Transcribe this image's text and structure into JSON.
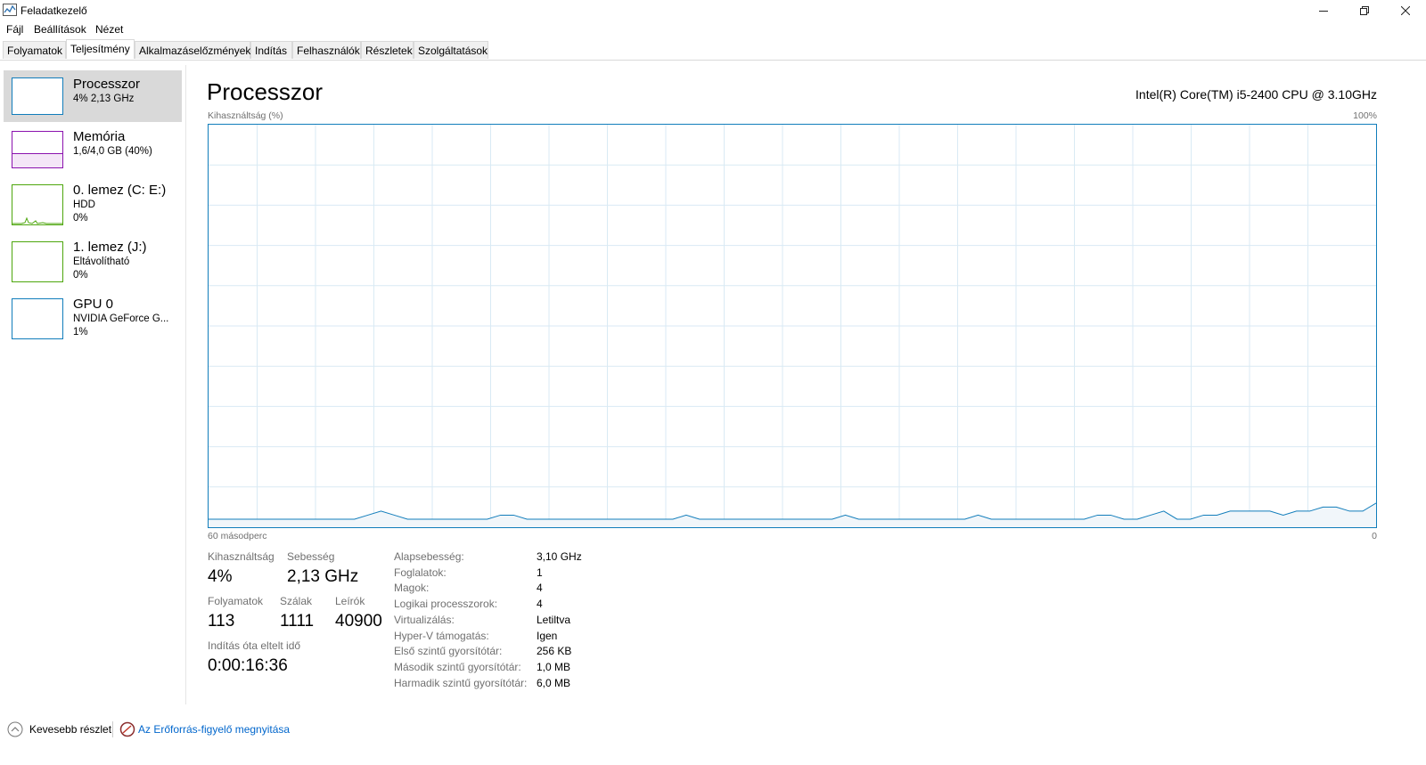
{
  "window": {
    "title": "Feladatkezelő",
    "minimize_icon": "minimize-icon",
    "restore_icon": "restore-icon",
    "close_icon": "close-icon"
  },
  "menu": [
    "Fájl",
    "Beállítások",
    "Nézet"
  ],
  "tabs": [
    "Folyamatok",
    "Teljesítmény",
    "Alkalmazáselőzmények",
    "Indítás",
    "Felhasználók",
    "Részletek",
    "Szolgáltatások"
  ],
  "active_tab": "Teljesítmény",
  "sidebar": {
    "items": [
      {
        "name": "Processzor",
        "sub1": "4% 2,13 GHz",
        "sub2": "",
        "color": "#117dbb",
        "selected": true
      },
      {
        "name": "Memória",
        "sub1": "1,6/4,0 GB (40%)",
        "sub2": "",
        "color": "#8b12ae",
        "selected": false
      },
      {
        "name": "0. lemez (C: E:)",
        "sub1": "HDD",
        "sub2": "0%",
        "color": "#4da60c",
        "selected": false
      },
      {
        "name": "1. lemez (J:)",
        "sub1": "Eltávolítható",
        "sub2": "0%",
        "color": "#4da60c",
        "selected": false
      },
      {
        "name": "GPU 0",
        "sub1": "NVIDIA GeForce G...",
        "sub2": "1%",
        "color": "#117dbb",
        "selected": false
      }
    ]
  },
  "main": {
    "title": "Processzor",
    "cpu_name": "Intel(R) Core(TM) i5-2400 CPU @ 3.10GHz",
    "graph_label": "Kihasználtság (%)",
    "graph_max": "100%",
    "graph_time": "60 másodperc",
    "graph_zero": "0",
    "graph_color": "#117dbb",
    "grid_color": "#d9eaf4"
  },
  "chart_data": {
    "type": "line",
    "ylabel": "Kihasználtság (%)",
    "ylim": [
      0,
      100
    ],
    "x_label_left": "60 másodperc",
    "x_label_right": "0",
    "grid": true,
    "series": [
      {
        "values": [
          2,
          2,
          2,
          2,
          2,
          2,
          2,
          2,
          2,
          2,
          2,
          2,
          3,
          4,
          3,
          2,
          2,
          2,
          2,
          2,
          2,
          2,
          3,
          3,
          2,
          2,
          2,
          2,
          2,
          2,
          2,
          2,
          2,
          2,
          2,
          2,
          3,
          2,
          2,
          2,
          2,
          2,
          2,
          2,
          2,
          2,
          2,
          2,
          3,
          2,
          2,
          2,
          2,
          2,
          2,
          2,
          2,
          2,
          3,
          2,
          2,
          2,
          2,
          2,
          2,
          2,
          2,
          3,
          3,
          2,
          2,
          3,
          4,
          2,
          2,
          3,
          3,
          4,
          4,
          4,
          4,
          3,
          4,
          4,
          5,
          5,
          4,
          4,
          6
        ]
      }
    ]
  },
  "stats": {
    "utilization_label": "Kihasználtság",
    "utilization": "4%",
    "speed_label": "Sebesség",
    "speed": "2,13 GHz",
    "processes_label": "Folyamatok",
    "processes": "113",
    "threads_label": "Szálak",
    "threads": "1111",
    "handles_label": "Leírók",
    "handles": "40900",
    "uptime_label": "Indítás óta eltelt idő",
    "uptime": "0:00:16:36"
  },
  "info": [
    {
      "label": "Alapsebesség:",
      "value": "3,10 GHz"
    },
    {
      "label": "Foglalatok:",
      "value": "1"
    },
    {
      "label": "Magok:",
      "value": "4"
    },
    {
      "label": "Logikai processzorok:",
      "value": "4"
    },
    {
      "label": "Virtualizálás:",
      "value": "Letiltva"
    },
    {
      "label": "Hyper-V támogatás:",
      "value": "Igen"
    },
    {
      "label": "Első szintű gyorsítótár:",
      "value": "256 KB"
    },
    {
      "label": "Második szintű gyorsítótár:",
      "value": "1,0 MB"
    },
    {
      "label": "Harmadik szintű gyorsítótár:",
      "value": "6,0 MB"
    }
  ],
  "footer": {
    "less_details": "Kevesebb részlet",
    "resource_monitor": "Az Erőforrás-figyelő megnyitása",
    "link_color": "#0066cc"
  }
}
